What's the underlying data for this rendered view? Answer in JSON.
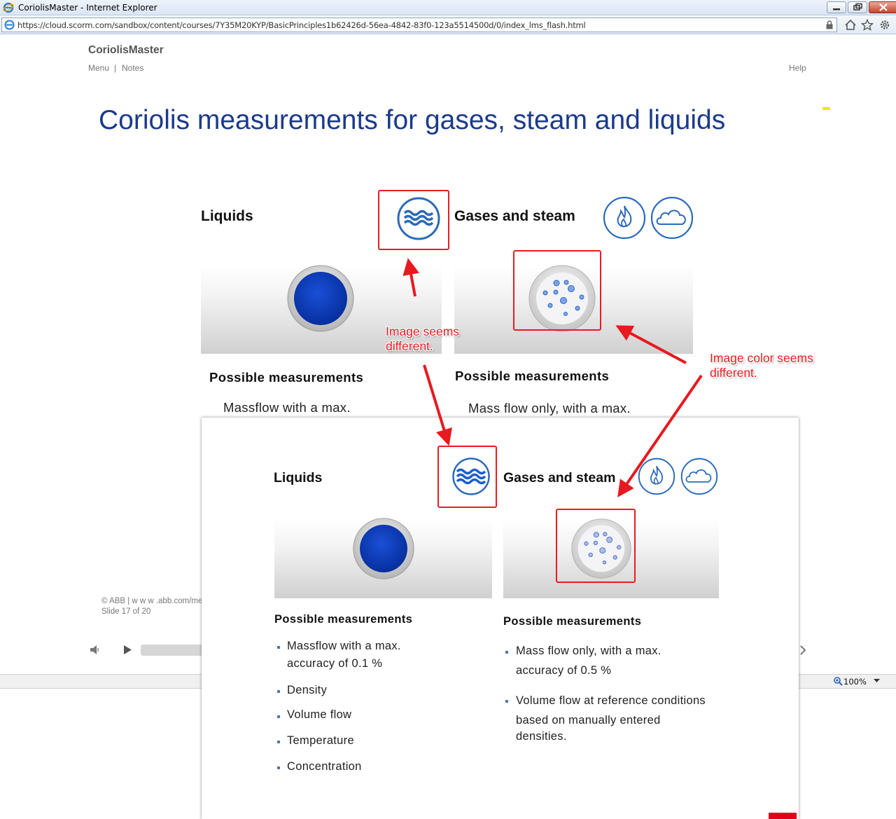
{
  "browser": {
    "window_title": "CoriolisMaster - Internet Explorer",
    "url": "https://cloud.scorm.com/sandbox/content/courses/7Y35M20KYP/BasicPrinciples1b62426d-56ea-4842-83f0-123a5514500d/0/index_lms_flash.html",
    "zoom": "100%"
  },
  "course": {
    "brand": "CoriolisMaster",
    "nav": {
      "menu": "Menu",
      "separator": "|",
      "notes": "Notes",
      "help": "Help"
    },
    "slide_title": "Coriolis measurements for gases, steam and liquids",
    "liquids": {
      "label": "Liquids",
      "possible_label": "Possible measurements",
      "first_line": "Massflow with a max."
    },
    "gases": {
      "label": "Gases and steam",
      "possible_label": "Possible measurements",
      "first_line": "Mass flow only, with a max."
    },
    "footer": {
      "copyright": "© ABB | w w w .abb.com/me",
      "slide_counter": "Slide 17 of 20"
    }
  },
  "annotations": {
    "image_different": "Image seems\ndifferent.",
    "color_different": "Image color seems\ndifferent.",
    "colors": {
      "arrow": "#e8191f",
      "box": "#e81c23"
    }
  },
  "overlay": {
    "liquids": {
      "label": "Liquids",
      "possible_label": "Possible measurements",
      "items": [
        {
          "line1": "Massflow with a max.",
          "line2": "accuracy of 0.1 %"
        },
        {
          "line1": "Density"
        },
        {
          "line1": "Volume flow"
        },
        {
          "line1": "Temperature"
        },
        {
          "line1": "Concentration"
        }
      ]
    },
    "gases": {
      "label": "Gases and steam",
      "possible_label": "Possible measurements",
      "items": [
        {
          "line1": "Mass flow only, with a max.",
          "line2": "accuracy of 0.5 %"
        },
        {
          "line1": "Volume flow at reference conditions",
          "line2": "based on manually entered",
          "line3": "densities."
        }
      ]
    }
  },
  "icons": [
    "ie-logo",
    "lock-icon",
    "home-icon",
    "favorites-star-icon",
    "tools-gear-icon",
    "wave-icon",
    "flame-icon",
    "cloud-icon",
    "liquid-ball-icon",
    "gas-bubbles-icon",
    "volume-icon",
    "play-icon",
    "chevron-right-icon",
    "zoom-icon"
  ],
  "theme": {
    "title_blue": "#1b3a8c",
    "icon_blue": "#2a6ab8",
    "ball_blue": "#0a3ec2"
  }
}
